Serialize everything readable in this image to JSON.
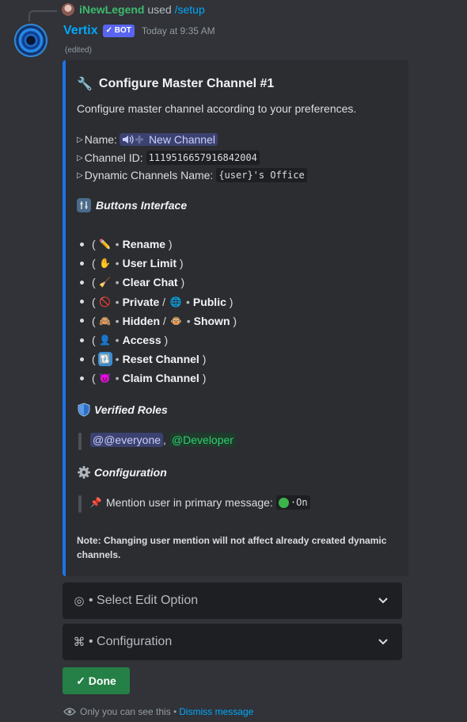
{
  "reply": {
    "username": "iNewLegend",
    "used": "used",
    "command": "/setup"
  },
  "message": {
    "author": "Vertix",
    "bot_badge": "✓ BOT",
    "timestamp": "Today at 9:35 AM",
    "edited": "(edited)"
  },
  "embed": {
    "title_icon": "🔧",
    "title": "Configure Master Channel #1",
    "description": "Configure master channel according to your preferences.",
    "fields": {
      "name_label": "Name:",
      "name_value": "New Channel",
      "id_label": "Channel ID:",
      "id_value": "1119516657916842004",
      "dynamic_label": "Dynamic Channels Name:",
      "dynamic_value": "{user}'s Office"
    },
    "buttons_interface": {
      "heading": "Buttons Interface",
      "items": [
        {
          "emoji": "✏️",
          "parts": [
            "Rename"
          ]
        },
        {
          "emoji": "✋",
          "parts": [
            "User Limit"
          ]
        },
        {
          "emoji": "🧹",
          "parts": [
            "Clear Chat"
          ]
        },
        {
          "emoji": "🚫",
          "parts": [
            "Private",
            "Public"
          ],
          "emoji2": "🌐"
        },
        {
          "emoji": "🙈",
          "parts": [
            "Hidden",
            "Shown"
          ],
          "emoji2": "🐵"
        },
        {
          "emoji": "👤",
          "parts": [
            "Access"
          ]
        },
        {
          "emoji": "🔃",
          "parts": [
            "Reset Channel"
          ]
        },
        {
          "emoji": "😈",
          "parts": [
            "Claim Channel"
          ]
        }
      ]
    },
    "verified_roles": {
      "heading": "Verified Roles",
      "roles": [
        "@@everyone",
        "@Developer"
      ],
      "separator": ","
    },
    "configuration": {
      "heading": "Configuration",
      "mention_label": "Mention user in primary message:",
      "mention_value": "On"
    },
    "note": "Note: Changing user mention will not affect already created dynamic channels."
  },
  "components": {
    "select_edit": {
      "icon": "◎",
      "placeholder": "• Select Edit Option"
    },
    "select_config": {
      "icon": "⌘",
      "placeholder": "• Configuration"
    },
    "done_button": "✓ Done"
  },
  "ephemeral": {
    "text": "Only you can see this •",
    "dismiss": "Dismiss message"
  },
  "colors": {
    "embed_border": "#1e73e8",
    "username": "#00a8fc",
    "reply_name": "#3fb96d",
    "done_button": "#248046"
  }
}
